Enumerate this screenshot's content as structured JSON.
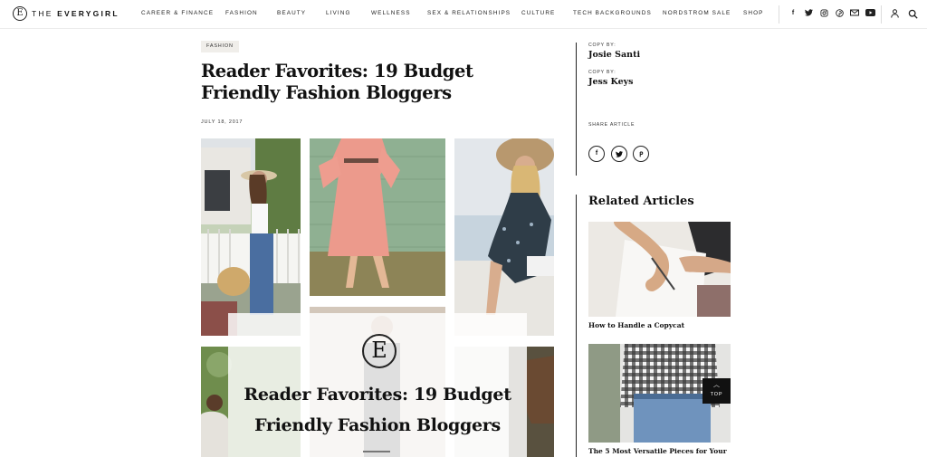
{
  "header": {
    "logo_mark": "E",
    "logo_the": "THE ",
    "logo_brand": "EVERYGIRL",
    "nav": [
      "CAREER & FINANCE",
      "FASHION",
      "BEAUTY",
      "LIVING",
      "WELLNESS",
      "SEX & RELATIONSHIPS",
      "CULTURE",
      "TECH BACKGROUNDS",
      "NORDSTROM SALE",
      "SHOP"
    ],
    "social_icons": [
      "facebook-icon",
      "twitter-icon",
      "instagram-icon",
      "pinterest-icon",
      "email-icon",
      "youtube-icon"
    ],
    "social_glyphs": [
      "f",
      "t",
      "◎",
      "p",
      "✉",
      "▶"
    ],
    "utility_icons": [
      "user-icon",
      "search-icon"
    ]
  },
  "article": {
    "tag": "FASHION",
    "title": "Reader Favorites: 19 Budget Friendly Fashion Bloggers",
    "date": "JULY 18, 2017",
    "overlay_logo": "E",
    "overlay_title": "Reader Favorites: 19 Budget Friendly Fashion Bloggers"
  },
  "sidebar": {
    "credits": [
      {
        "label": "COPY BY:",
        "name": "Josie Santi"
      },
      {
        "label": "COPY BY:",
        "name": "Jess Keys"
      }
    ],
    "share_label": "SHARE ARTICLE",
    "share_glyphs": [
      "f",
      "t",
      "p"
    ],
    "related_heading": "Related Articles",
    "related": [
      {
        "caption": "How to Handle a Copycat"
      },
      {
        "caption": "The 5 Most Versatile Pieces for Your"
      }
    ],
    "top_button": "TOP",
    "top_chevron": "︿"
  },
  "colors": {
    "accent": "#111111",
    "tag_bg": "#f0eeea",
    "divider": "#222222"
  }
}
